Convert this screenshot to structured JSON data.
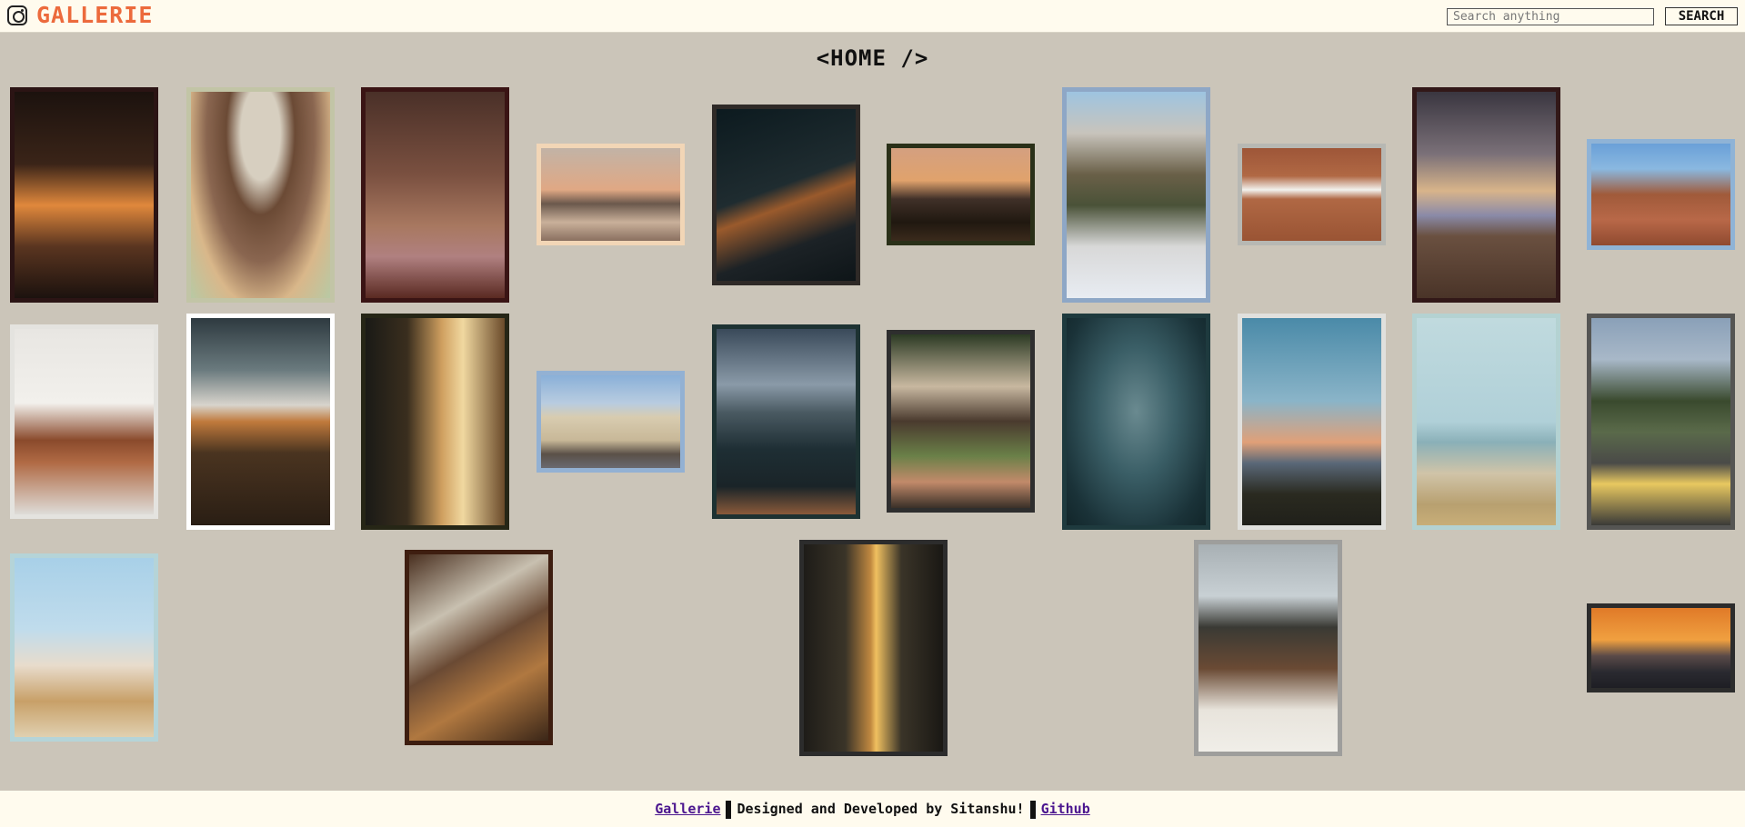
{
  "header": {
    "logo_icon": "instagram-icon",
    "brand": "GALLERIE",
    "brand_color": "#ec6a3c",
    "search_placeholder": "Search anything",
    "search_label": "SEARCH"
  },
  "page": {
    "title": "<HOME />"
  },
  "photos": [
    {
      "name": "photo-pier-underneath-sunset",
      "frame": "#2b1414",
      "bg": "linear-gradient(180deg,#1c120e 0%,#3a2418 35%,#e0883c 55%,#5a3520 75%,#1c120e 100%)"
    },
    {
      "name": "photo-man-bucket-hat-green-glasses",
      "frame": "#c2c5a6",
      "bg": "radial-gradient(ellipse at 50% 20%,#d7cfc0 0%,#d7cfc0 20%,#6b4a35 35%,#8a6650 55%,#d9b78a 75%,#b8c9a4 100%)"
    },
    {
      "name": "photo-rustic-wall-frames",
      "frame": "#3a1414",
      "bg": "linear-gradient(180deg,#4a3028 0%,#7a5040 40%,#a87860 65%,#b08080 80%,#5a2a22 100%)"
    },
    {
      "name": "photo-pier-sunset-wide",
      "frame": "#f2d6b6",
      "bg": "linear-gradient(180deg,#c2b3a6 0%,#e0a884 45%,#6a584c 60%,#c9b09a 80%,#8a7060 100%)"
    },
    {
      "name": "photo-neon-make-yourself-priority",
      "frame": "#2f2a27",
      "bg": "linear-gradient(160deg,#0c1a1f 0%,#1f2c30 45%,#9a5a2c 55%,#1c2226 75%,#0e1518 100%)"
    },
    {
      "name": "photo-couple-silhouette-beach",
      "frame": "#2a3018",
      "bg": "linear-gradient(180deg,#d4a080 0%,#e0a26c 35%,#403028 55%,#201810 80%,#3a2a1c 100%)"
    },
    {
      "name": "photo-snowy-mountain-valley",
      "frame": "#8ea7c6",
      "bg": "linear-gradient(180deg,#9ec4e0 0%,#c8c4bc 20%,#6a6048 40%,#4a5238 55%,#d8d8d8 75%,#e8ecf2 100%)"
    },
    {
      "name": "photo-brick-building-windows",
      "frame": "#b7b8b3",
      "bg": "linear-gradient(180deg,#9e5638 0%,#b06844 30%,#f2f2ee 45%,#b06844 55%,#9a5434 100%)"
    },
    {
      "name": "photo-cloudy-sunset-sea",
      "frame": "#321818",
      "bg": "linear-gradient(180deg,#3a3640 0%,#7a7078 30%,#d8b48a 48%,#8a8aa8 60%,#6a5040 70%,#4a3428 100%)"
    },
    {
      "name": "photo-red-rock-lake-mountains",
      "frame": "#8fb3d6",
      "bg": "linear-gradient(180deg,#6aa0d8 0%,#8ab8e0 25%,#a05a3a 50%,#b86848 75%,#904a30 100%)"
    },
    {
      "name": "photo-living-room-arc-lamp",
      "frame": "#e4e3df",
      "bg": "linear-gradient(180deg,#e8e6e2 0%,#f2f0ec 40%,#8a4a2c 60%,#b06a44 72%,#dedcd8 100%)"
    },
    {
      "name": "photo-drone-field-sunset",
      "frame": "#ffffff",
      "bg": "linear-gradient(180deg,#2e3a40 0%,#6a7a7e 25%,#d8d4cc 42%,#c07a3c 50%,#4a3420 65%,#2a1e14 100%)"
    },
    {
      "name": "photo-woman-night-street",
      "frame": "#262616",
      "bg": "linear-gradient(90deg,#1a1a16 0%,#3a2e1e 30%,#d0a060 55%,#f0d8a0 70%,#6a4a2a 100%)"
    },
    {
      "name": "photo-arc-de-triomphe",
      "frame": "#93b1d3",
      "bg": "linear-gradient(180deg,#8ab0d8 0%,#b8cce0 30%,#d8ccb0 45%,#c8b898 70%,#5a5048 85%,#6a6a70 100%)"
    },
    {
      "name": "photo-dark-sea-rocks",
      "frame": "#1d3232",
      "bg": "linear-gradient(180deg,#3a4a5a 0%,#8a9aa8 30%,#4a5a62 45%,#1e2e34 65%,#1a2428 85%,#8a5a3a 100%)"
    },
    {
      "name": "photo-courtyard-plants",
      "frame": "#2e2e2e",
      "bg": "linear-gradient(180deg,#2c3a24 0%,#c8b8a0 30%,#4a3a2e 50%,#6a8048 70%,#c28a6a 85%,#3a3028 100%)"
    },
    {
      "name": "photo-underwater-diver",
      "frame": "#1e3a3e",
      "bg": "radial-gradient(ellipse at 50% 45%,#6a8a90 0%,#3a5e66 40%,#1a3238 80%,#12262a 100%)"
    },
    {
      "name": "photo-lifeguard-tower-sunset",
      "frame": "#e0e0dd",
      "bg": "linear-gradient(180deg,#4a8aa8 0%,#8ab4c8 40%,#e0a078 60%,#5a6878 70%,#2a2a20 85%,#20201a 100%)"
    },
    {
      "name": "photo-hazy-beach",
      "frame": "#b4d2d2",
      "bg": "linear-gradient(180deg,#c0dade 0%,#b0d0d8 50%,#8ab0b8 60%,#d0c4a8 75%,#b8a070 90%,#c8ae78 100%)"
    },
    {
      "name": "photo-mountain-road-lines",
      "frame": "#555553",
      "bg": "linear-gradient(180deg,#8aa0b8 0%,#a8b8c8 20%,#3a4a2e 40%,#5a6a4a 55%,#4a4a48 70%,#e8c860 80%,#3a3a38 100%)"
    },
    {
      "name": "photo-coastal-village",
      "frame": "#b5d4d8",
      "bg": "linear-gradient(180deg,#a8d0e8 0%,#c0dcec 40%,#e8dccc 60%,#c8a068 80%,#e0d0b0 100%)"
    },
    {
      "name": "photo-design-moodboard-flatlay",
      "frame": "#3e1e10",
      "bg": "linear-gradient(150deg,#4a3020 0%,#c8c0b0 30%,#6a4a34 50%,#b07840 70%,#3a2618 100%)"
    },
    {
      "name": "photo-belief-corridor",
      "frame": "#2c2c2c",
      "bg": "linear-gradient(90deg,#1e1c18 0%,#3a3428 30%,#c08840 48%,#f0c060 52%,#3a3428 70%,#1a1814 100%)"
    },
    {
      "name": "photo-woman-mountains",
      "frame": "#9e9e9c",
      "bg": "linear-gradient(180deg,#a8b0b4 0%,#c8d0d4 25%,#3a3a34 40%,#6a4a34 60%,#e8e4dc 80%,#f0eee8 100%)"
    },
    {
      "name": "photo-mountain-silhouette-sunset",
      "frame": "#2c2c2c",
      "bg": "linear-gradient(180deg,#e07a28 0%,#f0a040 40%,#5a4a48 60%,#2a2a30 80%,#1e1e24 100%)"
    }
  ],
  "footer": {
    "link_left": "Gallerie",
    "credit": "Designed and Developed by Sitanshu!",
    "link_right": "Github"
  }
}
